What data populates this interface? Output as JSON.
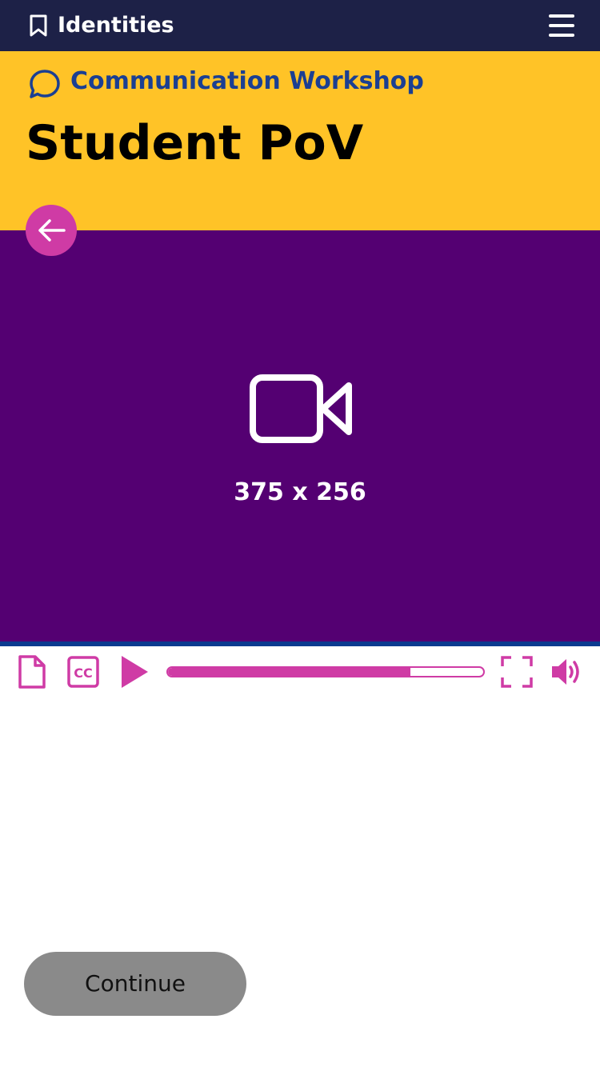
{
  "header": {
    "title": "Identities",
    "bookmark_icon": "bookmark-icon",
    "menu_icon": "hamburger-menu-icon"
  },
  "banner": {
    "section": "Communication Workshop",
    "page_title": "Student PoV",
    "section_icon": "chat-bubble-icon"
  },
  "video": {
    "placeholder_label": "375 x 256",
    "icon": "video-camera-icon"
  },
  "controls": {
    "icons": [
      "transcript-document-icon",
      "closed-captions-icon",
      "play-icon",
      "fullscreen-icon",
      "volume-icon"
    ],
    "cc_label": "CC",
    "progress": 0.77
  },
  "footer": {
    "continue_label": "Continue"
  },
  "colors": {
    "nav_bg": "#1d2147",
    "banner_bg": "#ffc327",
    "section_text": "#1b3f92",
    "accent": "#cf3ba5",
    "video_bg": "#540072",
    "button_bg": "#8a8a8a"
  }
}
